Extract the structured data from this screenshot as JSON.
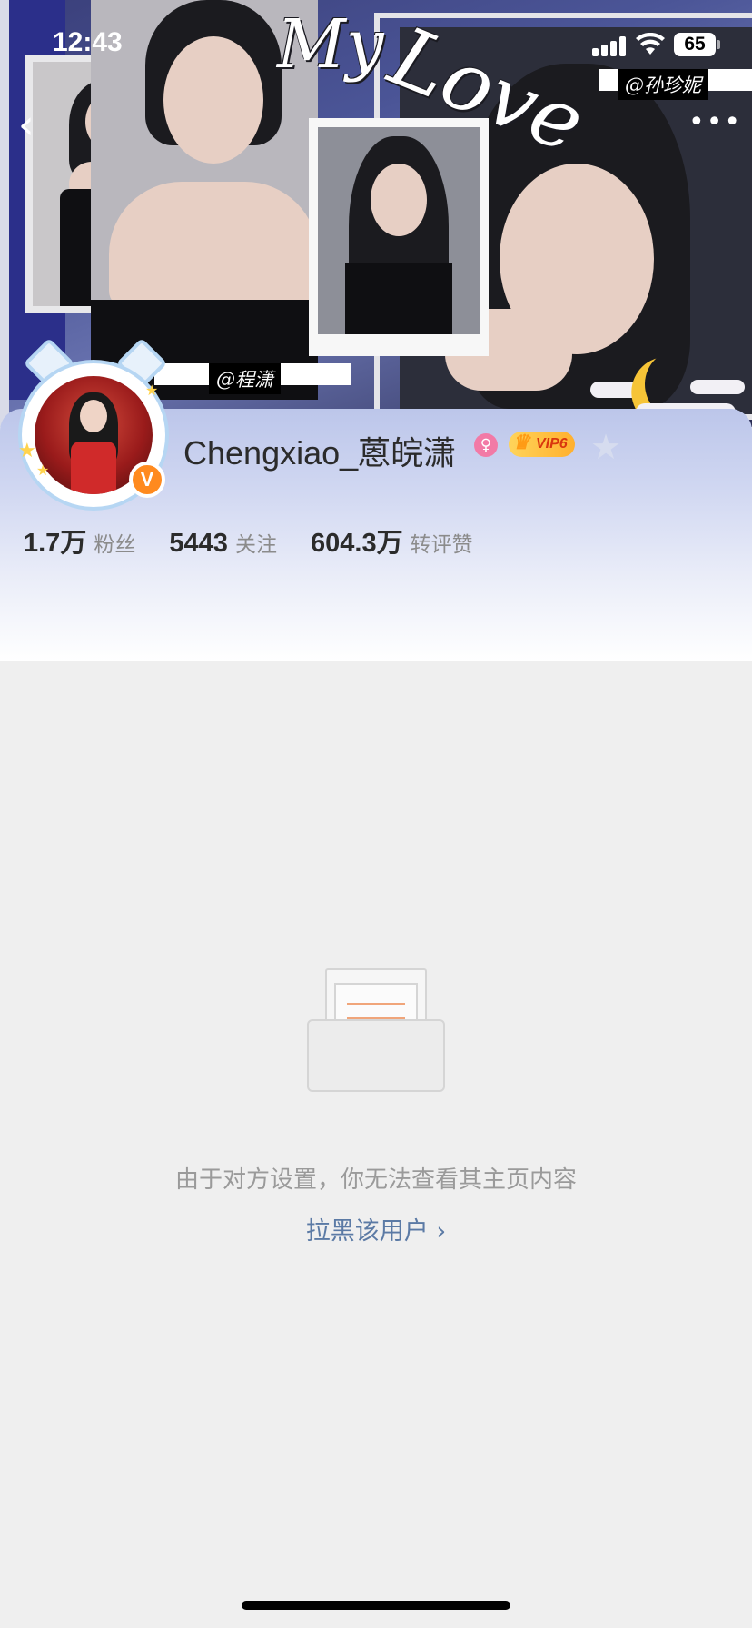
{
  "status_bar": {
    "time": "12:43",
    "battery": "65"
  },
  "banner": {
    "title_my": "My",
    "title_love": "Love",
    "tag_top": "@孙珍妮",
    "tag_bottom": "@程潇"
  },
  "nav": {
    "back_glyph": "‹",
    "more_glyph": "•••"
  },
  "profile": {
    "username": "Chengxiao_蒽皖潇",
    "verified_glyph": "V",
    "gender_glyph": "♀",
    "vip_label": "VIP6",
    "stats": [
      {
        "value": "1.7万",
        "label": "粉丝"
      },
      {
        "value": "5443",
        "label": "关注"
      },
      {
        "value": "604.3万",
        "label": "转评赞"
      }
    ]
  },
  "empty_state": {
    "message": "由于对方设置，你无法查看其主页内容",
    "block_link": "拉黑该用户 ›"
  },
  "colors": {
    "accent_link": "#5b7aa5",
    "verified_orange": "#ff8a1f",
    "gender_pink": "#f27aa6",
    "vip_gold": "#ffc13a",
    "page_bg": "#efefef"
  },
  "icons": [
    "back-icon",
    "more-icon",
    "signal-icon",
    "wifi-icon",
    "battery-icon",
    "verified-icon",
    "female-icon",
    "vip-crown-icon",
    "empty-box-icon",
    "chevron-right-icon"
  ]
}
